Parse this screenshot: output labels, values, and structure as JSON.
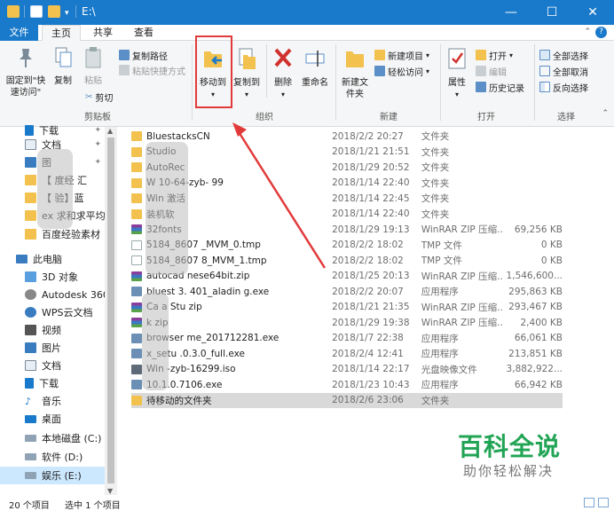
{
  "window": {
    "title": "E:\\"
  },
  "tabs": {
    "file": "文件",
    "home": "主页",
    "share": "共享",
    "view": "查看"
  },
  "ribbon": {
    "pin_label": "固定到\"快速访问\"",
    "copy_label": "复制",
    "paste_label": "粘贴",
    "copy_path": "复制路径",
    "paste_shortcut": "粘贴快捷方式",
    "cut": "剪切",
    "clipboard_group": "剪贴板",
    "move_to": "移动到",
    "copy_to": "复制到",
    "delete": "删除",
    "rename": "重命名",
    "organize_group": "组织",
    "new_folder": "新建文件夹",
    "new_item": "新建项目",
    "easy_access": "轻松访问",
    "new_group": "新建",
    "properties": "属性",
    "open": "打开",
    "edit": "编辑",
    "history": "历史记录",
    "open_group": "打开",
    "select_all": "全部选择",
    "select_none": "全部取消",
    "invert_selection": "反向选择",
    "select_group": "选择"
  },
  "nav": {
    "items": [
      {
        "label": "下载"
      },
      {
        "label": "文档"
      },
      {
        "label": "图"
      },
      {
        "label": "【   度经   汇"
      },
      {
        "label": "【   验】蓝"
      },
      {
        "label": "ex   求和求平均"
      },
      {
        "label": "百度经验素材"
      },
      {
        "label": "此电脑"
      },
      {
        "label": "3D 对象"
      },
      {
        "label": "Autodesk 360"
      },
      {
        "label": "WPS云文档"
      },
      {
        "label": "视频"
      },
      {
        "label": "图片"
      },
      {
        "label": "文档"
      },
      {
        "label": "下载"
      },
      {
        "label": "音乐"
      },
      {
        "label": "桌面"
      },
      {
        "label": "本地磁盘 (C:)"
      },
      {
        "label": "软件 (D:)"
      },
      {
        "label": "娱乐 (E:)"
      }
    ]
  },
  "files": [
    {
      "name": "BluestacksCN",
      "date": "2018/2/2 20:27",
      "type": "文件夹",
      "size": "",
      "icon": "folder"
    },
    {
      "name": "      Studio",
      "date": "2018/1/21 21:51",
      "type": "文件夹",
      "size": "",
      "icon": "folder"
    },
    {
      "name": "AutoRec",
      "date": "2018/1/29 20:52",
      "type": "文件夹",
      "size": "",
      "icon": "folder"
    },
    {
      "name": "W   10-64-zyb-   99",
      "date": "2018/1/14 22:40",
      "type": "文件夹",
      "size": "",
      "icon": "folder"
    },
    {
      "name": "Win   激活",
      "date": "2018/1/14 22:45",
      "type": "文件夹",
      "size": "",
      "icon": "folder"
    },
    {
      "name": "装机软",
      "date": "2018/1/14 22:40",
      "type": "文件夹",
      "size": "",
      "icon": "folder"
    },
    {
      "name": "32fonts",
      "date": "2018/1/29 19:13",
      "type": "WinRAR ZIP 压缩...",
      "size": "69,256 KB",
      "icon": "zip"
    },
    {
      "name": "5184_8607      _MVM_0.tmp",
      "date": "2018/2/2 18:02",
      "type": "TMP 文件",
      "size": "0 KB",
      "icon": "file"
    },
    {
      "name": "5184_8607   8_MVM_1.tmp",
      "date": "2018/2/2 18:02",
      "type": "TMP 文件",
      "size": "0 KB",
      "icon": "file"
    },
    {
      "name": "autocad   nese64bit.zip",
      "date": "2018/1/25 20:13",
      "type": "WinRAR ZIP 压缩...",
      "size": "1,546,600...",
      "icon": "zip"
    },
    {
      "name": "bluest   3.   401_aladin g.exe",
      "date": "2018/2/2 20:07",
      "type": "应用程序",
      "size": "295,863 KB",
      "icon": "exe"
    },
    {
      "name": "Ca   a Stu   zip",
      "date": "2018/1/21 21:35",
      "type": "WinRAR ZIP 压缩...",
      "size": "293,467 KB",
      "icon": "zip"
    },
    {
      "name": "k   zip",
      "date": "2018/1/29 19:38",
      "type": "WinRAR ZIP 压缩...",
      "size": "2,400 KB",
      "icon": "zip"
    },
    {
      "name": "browser   me_201712281.exe",
      "date": "2018/1/7 22:38",
      "type": "应用程序",
      "size": "66,061 KB",
      "icon": "exe"
    },
    {
      "name": "x_setu   .0.3.0_full.exe",
      "date": "2018/2/4 12:41",
      "type": "应用程序",
      "size": "213,851 KB",
      "icon": "exe"
    },
    {
      "name": "Win   -zyb-16299.iso",
      "date": "2018/1/14 22:17",
      "type": "光盘映像文件",
      "size": "3,882,922...",
      "icon": "iso"
    },
    {
      "name": "   10.1.0.7106.exe",
      "date": "2018/1/23 10:43",
      "type": "应用程序",
      "size": "66,942 KB",
      "icon": "exe"
    },
    {
      "name": "待移动的文件夹",
      "date": "2018/2/6 23:06",
      "type": "文件夹",
      "size": "",
      "icon": "folder"
    }
  ],
  "status": {
    "count": "20 个项目",
    "selected": "选中 1 个项目"
  },
  "watermark": {
    "brand": "百科全说",
    "tagline": "助你轻松解决"
  },
  "colors": {
    "accent": "#1979ca",
    "highlight": "#e23a3a",
    "folder": "#f2c14e"
  }
}
